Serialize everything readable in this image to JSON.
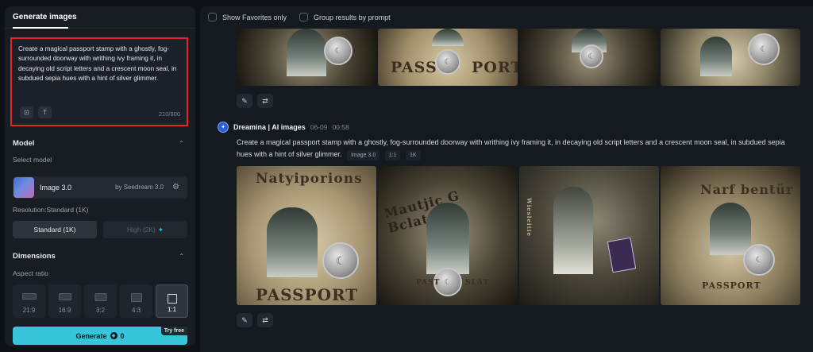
{
  "left_panel": {
    "tab_label": "Generate images",
    "prompt": {
      "text": "Create a magical passport stamp with a ghostly, fog-surrounded doorway with writhing ivy framing it, in decaying old script letters and a crescent moon seal, in subdued sepia hues with a hint of silver glimmer.",
      "char_count": "210/800"
    },
    "model_section": {
      "title": "Model",
      "select_label": "Select model",
      "model_name": "Image 3.0",
      "model_by": "by Seedream 3.0",
      "resolution_label": "Resolution:Standard (1K)",
      "res_standard": "Standard (1K)",
      "res_high": "High (2K)",
      "high_icon": "sparkle-icon"
    },
    "dimensions_section": {
      "title": "Dimensions",
      "aspect_label": "Aspect ratio",
      "ratios": [
        "21:9",
        "16:9",
        "3:2",
        "4:3",
        "1:1"
      ],
      "selected_ratio": "1:1"
    },
    "generate": {
      "label": "Generate",
      "cost": "0",
      "badge": "Try free"
    }
  },
  "right_panel": {
    "filters": {
      "favorites": "Show Favorites only",
      "group": "Group results by prompt"
    },
    "top_row_words": [
      "PASS",
      "PORT"
    ],
    "message": {
      "sender": "Dreamina | AI images",
      "date": "06-09",
      "time": "00:58",
      "prompt": "Create a magical passport stamp with a ghostly, fog-surrounded doorway with writhing ivy framing it, in decaying old script letters and a crescent moon seal, in subdued sepia hues with a hint of silver glimmer.",
      "chips": [
        "Image 3.0",
        "1:1",
        "1K"
      ]
    },
    "images": [
      {
        "title": "Natyiporions",
        "footer": "PASSPORT"
      },
      {
        "title": "Mautjic G Bclatre",
        "footer_left": "PAST",
        "footer_right": "SLAT"
      },
      {
        "title": "Wiesleitie",
        "footer": ""
      },
      {
        "title": "Narf bentür",
        "footer": "PASSPORT"
      }
    ]
  },
  "colors": {
    "accent": "#37c5dc",
    "prompt_border": "#e02626",
    "background": "#0e1116"
  }
}
